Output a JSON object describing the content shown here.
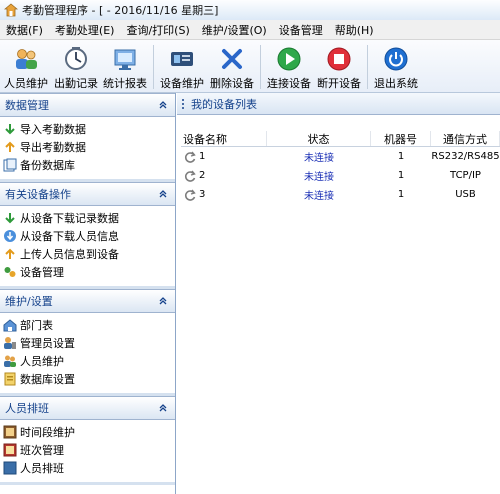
{
  "window": {
    "title": "考勤管理程序 - [ - 2016/11/16 星期三]"
  },
  "menu": [
    {
      "label": "数据(F)"
    },
    {
      "label": "考勤处理(E)"
    },
    {
      "label": "查询/打印(S)"
    },
    {
      "label": "维护/设置(O)"
    },
    {
      "label": "设备管理"
    },
    {
      "label": "帮助(H)"
    }
  ],
  "toolbar": {
    "person_maintain": "人员维护",
    "leave_record": "出勤记录",
    "stats_report": "统计报表",
    "device_maintain": "设备维护",
    "delete_device": "删除设备",
    "connect_device": "连接设备",
    "disconnect_device": "断开设备",
    "exit_system": "退出系统"
  },
  "sidebar": {
    "panels": [
      {
        "title": "数据管理",
        "items": [
          {
            "label": "导入考勤数据",
            "icon": "import-arrow-icon"
          },
          {
            "label": "导出考勤数据",
            "icon": "export-arrow-icon"
          },
          {
            "label": "备份数据库",
            "icon": "backup-icon"
          }
        ]
      },
      {
        "title": "有关设备操作",
        "items": [
          {
            "label": "从设备下载记录数据",
            "icon": "download-arrow-icon"
          },
          {
            "label": "从设备下载人员信息",
            "icon": "download-person-icon"
          },
          {
            "label": "上传人员信息到设备",
            "icon": "upload-arrow-icon"
          },
          {
            "label": "设备管理",
            "icon": "device-manage-icon"
          }
        ]
      },
      {
        "title": "维护/设置",
        "items": [
          {
            "label": "部门表",
            "icon": "department-icon"
          },
          {
            "label": "管理员设置",
            "icon": "admin-icon"
          },
          {
            "label": "人员维护",
            "icon": "people-icon"
          },
          {
            "label": "数据库设置",
            "icon": "database-icon"
          }
        ]
      },
      {
        "title": "人员排班",
        "items": [
          {
            "label": "时间段维护",
            "icon": "time-icon"
          },
          {
            "label": "班次管理",
            "icon": "shift-icon"
          },
          {
            "label": "人员排班",
            "icon": "schedule-icon"
          }
        ]
      }
    ]
  },
  "content": {
    "title": "我的设备列表",
    "columns": [
      "设备名称",
      "状态",
      "机器号",
      "通信方式"
    ],
    "rows": [
      {
        "name": "1",
        "status": "未连接",
        "id": "1",
        "comm": "RS232/RS485"
      },
      {
        "name": "2",
        "status": "未连接",
        "id": "1",
        "comm": "TCP/IP"
      },
      {
        "name": "3",
        "status": "未连接",
        "id": "1",
        "comm": "USB"
      }
    ]
  },
  "colors": {
    "accent": "#15428b",
    "status": "#1a2fb5"
  }
}
